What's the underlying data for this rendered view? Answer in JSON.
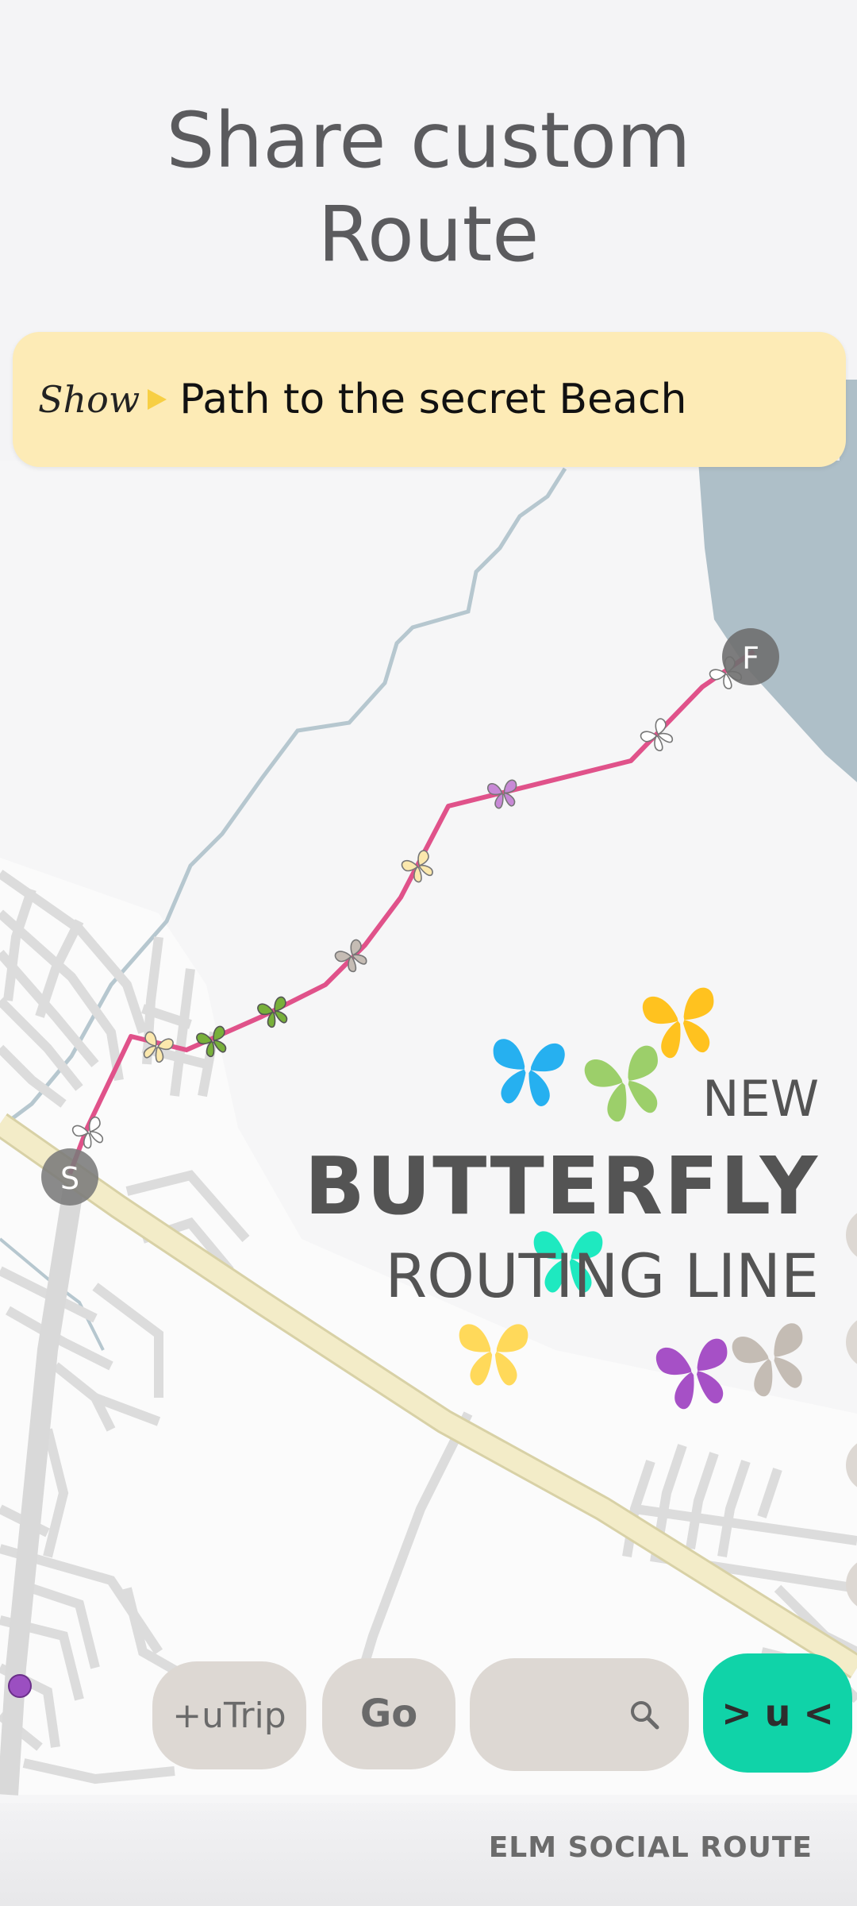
{
  "header": {
    "line1": "Share custom",
    "line2": "Route"
  },
  "banner": {
    "show_label": "Show",
    "destination": "Path to the secret Beach"
  },
  "map": {
    "start_marker": "S",
    "finish_marker": "F",
    "route_color": "#e0528a",
    "water_color": "#aebfc8",
    "highway_color": "#f3ecc8"
  },
  "promo": {
    "new": "NEW",
    "title": "BUTTERFLY",
    "subtitle": "ROUTING LINE"
  },
  "butterfly_colors": [
    "#26b0f0",
    "#9ccf6a",
    "#ffc21f",
    "#1ee9c0",
    "#ffd95a",
    "#a650c6",
    "#c4bcb4"
  ],
  "toolbar": {
    "trip_label": "+uTrip",
    "go_label": "Go",
    "search_icon": "search-icon",
    "action_label": "> u <"
  },
  "footer": {
    "label": "ELM SOCIAL ROUTE"
  }
}
